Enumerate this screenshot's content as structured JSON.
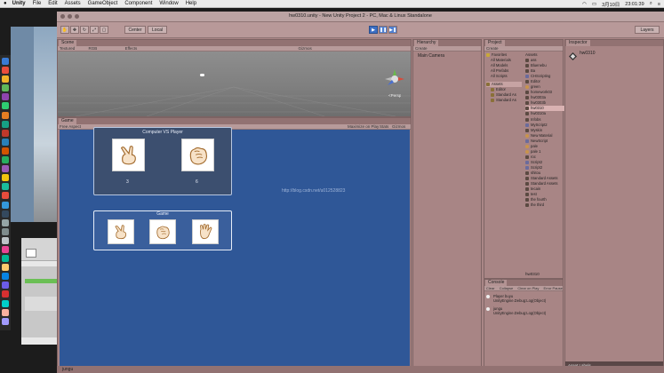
{
  "menubar": {
    "app": "Unity",
    "items": [
      "File",
      "Edit",
      "Assets",
      "GameObject",
      "Component",
      "Window",
      "Help"
    ],
    "date": "3月10日",
    "time": "23:01:39"
  },
  "window": {
    "title": "hw0310.unity - New Unity Project 2 - PC, Mac & Linux Standalone"
  },
  "toolbar": {
    "center": "Center",
    "local": "Local",
    "layers": "Layers"
  },
  "scene": {
    "tab": "Scene",
    "shading": "Textured",
    "rgb": "RGB",
    "effects": "Effects",
    "gizmos": "Gizmos",
    "persp": "<Persp"
  },
  "game": {
    "tab": "Game",
    "aspect": "Free Aspect",
    "maximize": "Maximize on Play",
    "stats": "Stats",
    "gizmos": "Gizmos",
    "header": "Computer  VS  Player",
    "computer_score": "3",
    "player_score": "6",
    "section": "Game",
    "watermark": "http://blog.csdn.net/u012528823"
  },
  "hierarchy": {
    "tab": "Hierarchy",
    "create": "Create",
    "item": "Main Camera"
  },
  "project": {
    "tab": "Project",
    "create": "Create",
    "favorites": [
      "Favorites",
      "All Materials",
      "All Models",
      "All Prefabs",
      "All Scripts"
    ],
    "assets_header": "Assets",
    "tree": [
      "Assets",
      "Editor",
      "Standard As",
      "Standard As"
    ],
    "assets": [
      "ass",
      "Bluenebu",
      "Ba",
      "CHScripting",
      "Editor",
      "green",
      "homework03",
      "hw0303a",
      "hw0303b",
      "hw0310",
      "hw0310a",
      "Infobs",
      "MyScript2",
      "Myskin",
      "New Material",
      "NewScript",
      "pale",
      "pale 1",
      "roc",
      "Script2",
      "Script2",
      "shitou",
      "Standard Assets",
      "Standard Assets",
      "tecain",
      "test",
      "the fourth",
      "the third"
    ],
    "selected_index": 9,
    "footer": "hw0310"
  },
  "console": {
    "tab": "Console",
    "buttons": [
      "Clear",
      "Collapse",
      "Clear on Play",
      "Error Pause"
    ],
    "logs": [
      {
        "line1": "Player buyu",
        "line2": "UnityEngine.Debug:Log(Object)"
      },
      {
        "line1": "jungu",
        "line2": "UnityEngine.Debug:Log(Object)"
      }
    ]
  },
  "inspector": {
    "tab": "Inspector",
    "asset": "hw0310",
    "asset_labels": "Asset Labels"
  },
  "status": {
    "text": "jungu"
  },
  "colors": {
    "game_bg": "#2f5797",
    "panel": "#a88585",
    "play_button": "#3d6fc4"
  }
}
